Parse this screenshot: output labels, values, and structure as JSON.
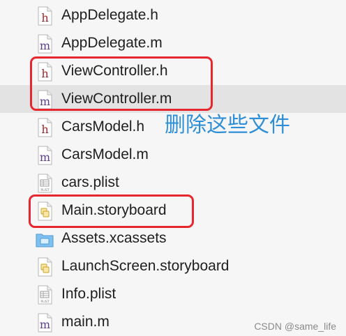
{
  "files": [
    {
      "name": "AppDelegate.h",
      "type": "h",
      "selected": false
    },
    {
      "name": "AppDelegate.m",
      "type": "m",
      "selected": false
    },
    {
      "name": "ViewController.h",
      "type": "h",
      "selected": false
    },
    {
      "name": "ViewController.m",
      "type": "m",
      "selected": true
    },
    {
      "name": "CarsModel.h",
      "type": "h",
      "selected": false
    },
    {
      "name": "CarsModel.m",
      "type": "m",
      "selected": false
    },
    {
      "name": "cars.plist",
      "type": "plist",
      "selected": false
    },
    {
      "name": "Main.storyboard",
      "type": "storyboard",
      "selected": false
    },
    {
      "name": "Assets.xcassets",
      "type": "folder",
      "selected": false
    },
    {
      "name": "LaunchScreen.storyboard",
      "type": "storyboard",
      "selected": false
    },
    {
      "name": "Info.plist",
      "type": "plist",
      "selected": false
    },
    {
      "name": "main.m",
      "type": "m",
      "selected": false
    }
  ],
  "annotation": {
    "text": "删除这些文件",
    "color": "#2f8fd6"
  },
  "highlight_color": "#e8262d",
  "watermark": "CSDN @same_life",
  "icons": {
    "h": "header-file-icon",
    "m": "implementation-file-icon",
    "plist": "plist-file-icon",
    "storyboard": "storyboard-file-icon",
    "folder": "asset-catalog-folder-icon"
  }
}
